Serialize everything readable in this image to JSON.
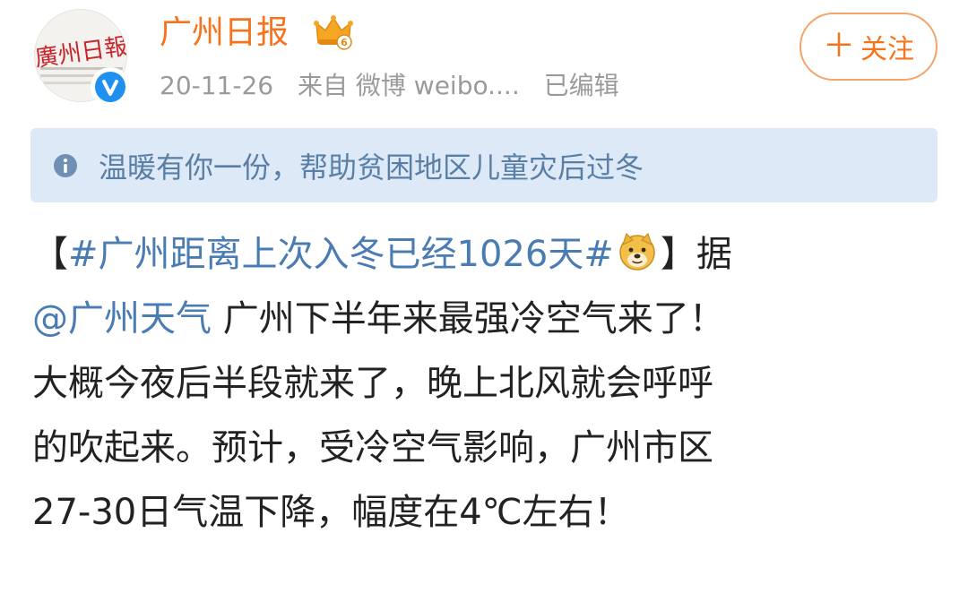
{
  "header": {
    "user_name": "广州日报",
    "timestamp": "20-11-26",
    "source": "来自 微博 weibo....",
    "edited_label": "已编辑",
    "follow_label": "关注",
    "avatar_text": "廣州日報"
  },
  "notice": {
    "text": "温暖有你一份，帮助贫困地区儿童灾后过冬"
  },
  "post": {
    "open_bracket": "【",
    "hashtag": "#广州距离上次入冬已经1026天#",
    "close_bracket": "】",
    "line1_tail": "据",
    "mention": "@广州天气",
    "line2_tail": " 广州下半年来最强冷空气来了！",
    "line3": "大概今夜后半段就来了，晚上北风就会呼呼",
    "line4": "的吹起来。预计，受冷空气影响，广州市区",
    "line5": "27-30日气温下降，幅度在4℃左右！"
  },
  "colors": {
    "accent": "#f7731b",
    "link": "#4a7cb4",
    "notice_bg": "#dde9f6",
    "verified": "#1f8ff0"
  },
  "icons": {
    "verified": "verified-badge-icon",
    "crown": "crown-icon",
    "info": "info-icon",
    "emoji": "doge-emoji-icon"
  }
}
